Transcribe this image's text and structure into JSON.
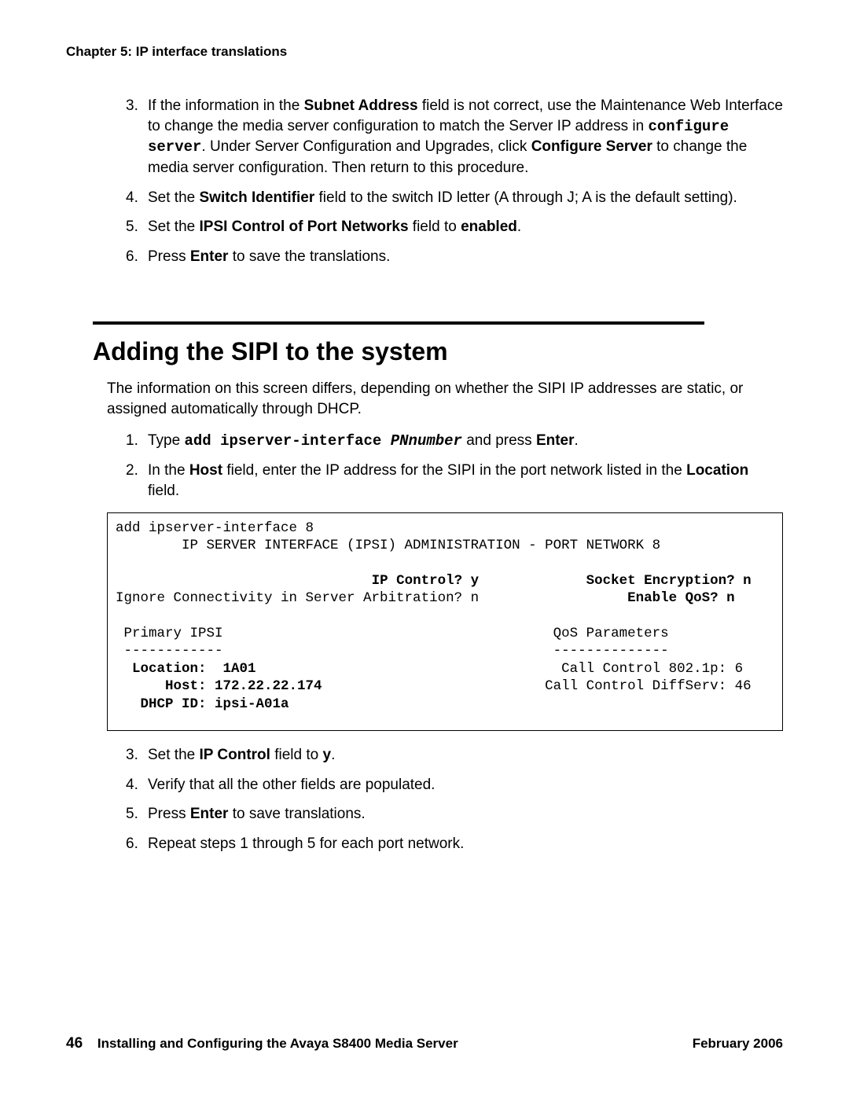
{
  "header": {
    "chapter": "Chapter 5: IP interface translations"
  },
  "list1": {
    "start": 2,
    "items": [
      {
        "p1": "If the information in the ",
        "b1": "Subnet Address",
        "p2": " field is not correct, use the Maintenance Web Interface to change the media server configuration to match the Server IP address in ",
        "c1": "configure server",
        "p3": ". Under Server Configuration and Upgrades, click ",
        "b2": "Configure Server",
        "p4": " to change the media server configuration. Then return to this procedure."
      },
      {
        "p1": "Set the ",
        "b1": "Switch Identifier",
        "p2": " field to the switch ID letter (A through J; A is the default setting)."
      },
      {
        "p1": "Set the ",
        "b1": "IPSI Control of Port Networks",
        "p2": "  field to ",
        "b2": "enabled",
        "p3": "."
      },
      {
        "p1": "Press ",
        "b1": "Enter",
        "p2": " to save the translations."
      }
    ]
  },
  "section": {
    "title": "Adding the SIPI to the system",
    "intro": "The information on this screen differs, depending on whether the SIPI IP addresses are static, or assigned automatically through DHCP."
  },
  "list2": {
    "start": 0,
    "items": [
      {
        "p1": "Type ",
        "c1": "add ipserver-interface ",
        "ci1": "PNnumber",
        "p2": " and press ",
        "b1": "Enter",
        "p3": "."
      },
      {
        "p1": "In the ",
        "b1": "Host",
        "p2": " field, enter the IP address for the SIPI in the port network listed in the ",
        "b2": "Location",
        "p3": " field."
      }
    ]
  },
  "terminal": {
    "l1": "add ipserver-interface 8",
    "l2": "        IP SERVER INTERFACE (IPSI) ADMINISTRATION - PORT NETWORK 8",
    "l3": "",
    "l4a": "                               ",
    "l4b": "IP Control? y",
    "l4c": "             ",
    "l4d": "Socket Encryption? n",
    "l5a": "Ignore Connectivity in Server Arbitration? n                  ",
    "l5b": "Enable QoS? n",
    "l6": "",
    "l7": " Primary IPSI                                        QoS Parameters",
    "l8": " ------------                                        --------------",
    "l9a": "  ",
    "l9b": "Location:  1A01",
    "l9c": "                                     Call Control 802.1p: 6",
    "l10a": "      ",
    "l10b": "Host: 172.22.22.174",
    "l10c": "                           Call Control DiffServ: 46",
    "l11a": "   ",
    "l11b": "DHCP ID: ipsi-A01a"
  },
  "list3": {
    "start": 2,
    "items": [
      {
        "p1": "Set the ",
        "b1": "IP Control",
        "p2": " field to ",
        "b2": "y",
        "p3": "."
      },
      {
        "p1": "Verify that all the other fields are populated."
      },
      {
        "p1": "Press ",
        "b1": "Enter",
        "p2": " to save translations."
      },
      {
        "p1": "Repeat steps 1 through 5 for each port network."
      }
    ]
  },
  "footer": {
    "page": "46",
    "title": "Installing and Configuring the Avaya S8400 Media Server",
    "date": "February 2006"
  }
}
